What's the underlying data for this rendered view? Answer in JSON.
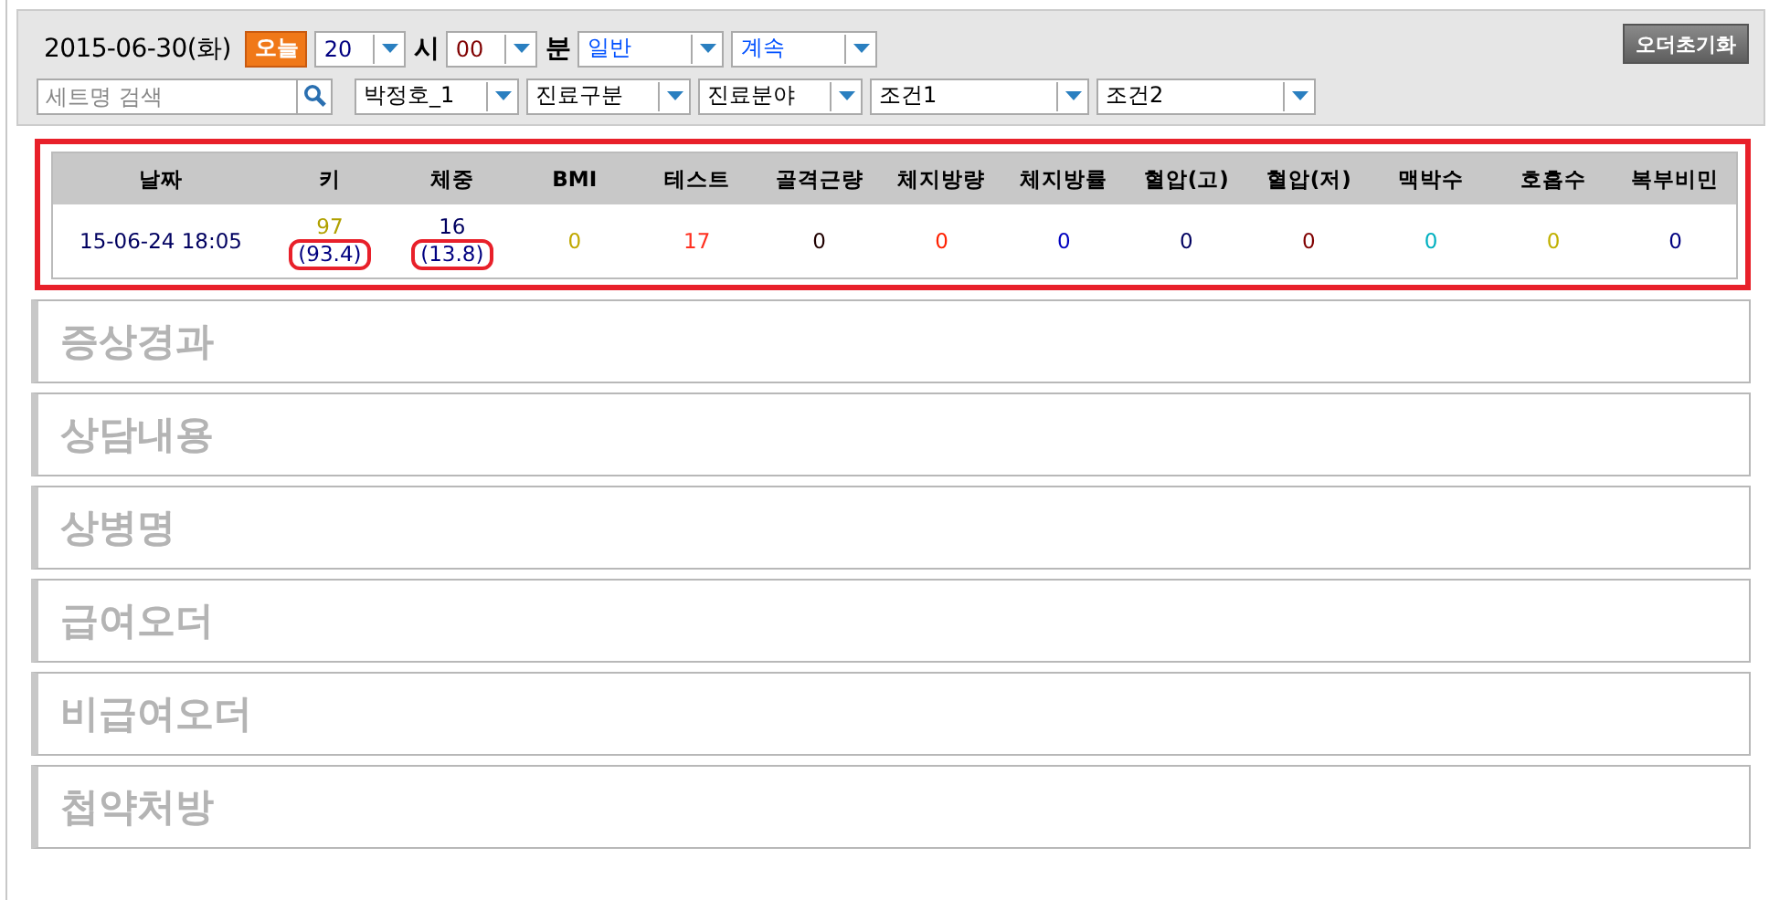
{
  "toolbar": {
    "date": "2015-06-30(화)",
    "today_button": "오늘",
    "hour": {
      "value": "20",
      "color": "#000080",
      "unit": "시"
    },
    "minute": {
      "value": "00",
      "color": "#800000",
      "unit": "분"
    },
    "selects": [
      {
        "value": "일반",
        "color": "#0050ff"
      },
      {
        "value": "계속",
        "color": "#0050ff"
      }
    ],
    "search": {
      "placeholder": "세트명 검색"
    },
    "filters": [
      {
        "value": "박정호_1"
      },
      {
        "value": "진료구분"
      },
      {
        "value": "진료분야"
      },
      {
        "value": "조건1"
      },
      {
        "value": "조건2"
      }
    ],
    "reset_button": "오더초기화"
  },
  "table": {
    "columns": [
      "날짜",
      "키",
      "체중",
      "BMI",
      "테스트",
      "골격근량",
      "체지방량",
      "체지방률",
      "혈압(고)",
      "혈압(저)",
      "맥박수",
      "호흡수",
      "복부비민"
    ],
    "rows": [
      {
        "cells": [
          {
            "value": "15-06-24 18:05",
            "color": "#000060"
          },
          {
            "value": "97",
            "color": "#b0a000",
            "sub": "(93.4)",
            "circled": true
          },
          {
            "value": "16",
            "color": "#000060",
            "sub": "(13.8)",
            "circled": true
          },
          {
            "value": "0",
            "color": "#c0a800"
          },
          {
            "value": "17",
            "color": "#ff3020"
          },
          {
            "value": "0",
            "color": "#200000"
          },
          {
            "value": "0",
            "color": "#ff2000"
          },
          {
            "value": "0",
            "color": "#0000c0"
          },
          {
            "value": "0",
            "color": "#000060"
          },
          {
            "value": "0",
            "color": "#800000"
          },
          {
            "value": "0",
            "color": "#00b0c0"
          },
          {
            "value": "0",
            "color": "#c0b000"
          },
          {
            "value": "0",
            "color": "#000080"
          }
        ]
      }
    ]
  },
  "sections": [
    {
      "label": "증상경과"
    },
    {
      "label": "상담내용"
    },
    {
      "label": "상병명"
    },
    {
      "label": "급여오더"
    },
    {
      "label": "비급여오더"
    },
    {
      "label": "첩약처방"
    }
  ]
}
